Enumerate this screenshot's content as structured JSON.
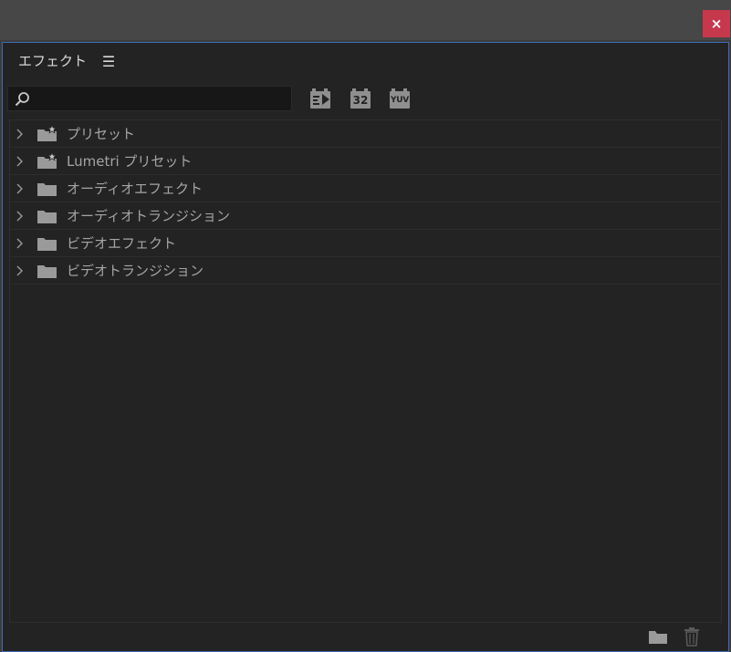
{
  "window": {
    "close_label": "×"
  },
  "panel": {
    "tab_title": "エフェクト",
    "menu_icon": "☰"
  },
  "search": {
    "placeholder": "",
    "value": ""
  },
  "filters": [
    {
      "name": "accelerated-effects-filter",
      "label": ""
    },
    {
      "name": "32bit-color-filter",
      "label": "32"
    },
    {
      "name": "yuv-filter",
      "label": "YUV"
    }
  ],
  "tree": {
    "items": [
      {
        "label": "プリセット",
        "icon": "folder-star-icon"
      },
      {
        "label": "Lumetri プリセット",
        "icon": "folder-star-icon"
      },
      {
        "label": "オーディオエフェクト",
        "icon": "folder-icon"
      },
      {
        "label": "オーディオトランジション",
        "icon": "folder-icon"
      },
      {
        "label": "ビデオエフェクト",
        "icon": "folder-icon"
      },
      {
        "label": "ビデオトランジション",
        "icon": "folder-icon"
      }
    ]
  },
  "colors": {
    "background": "#232323",
    "panel_border": "#3e6bb5",
    "close_button": "#c6394d",
    "text": "#a5a5a5",
    "icon": "#9a9a9a"
  }
}
